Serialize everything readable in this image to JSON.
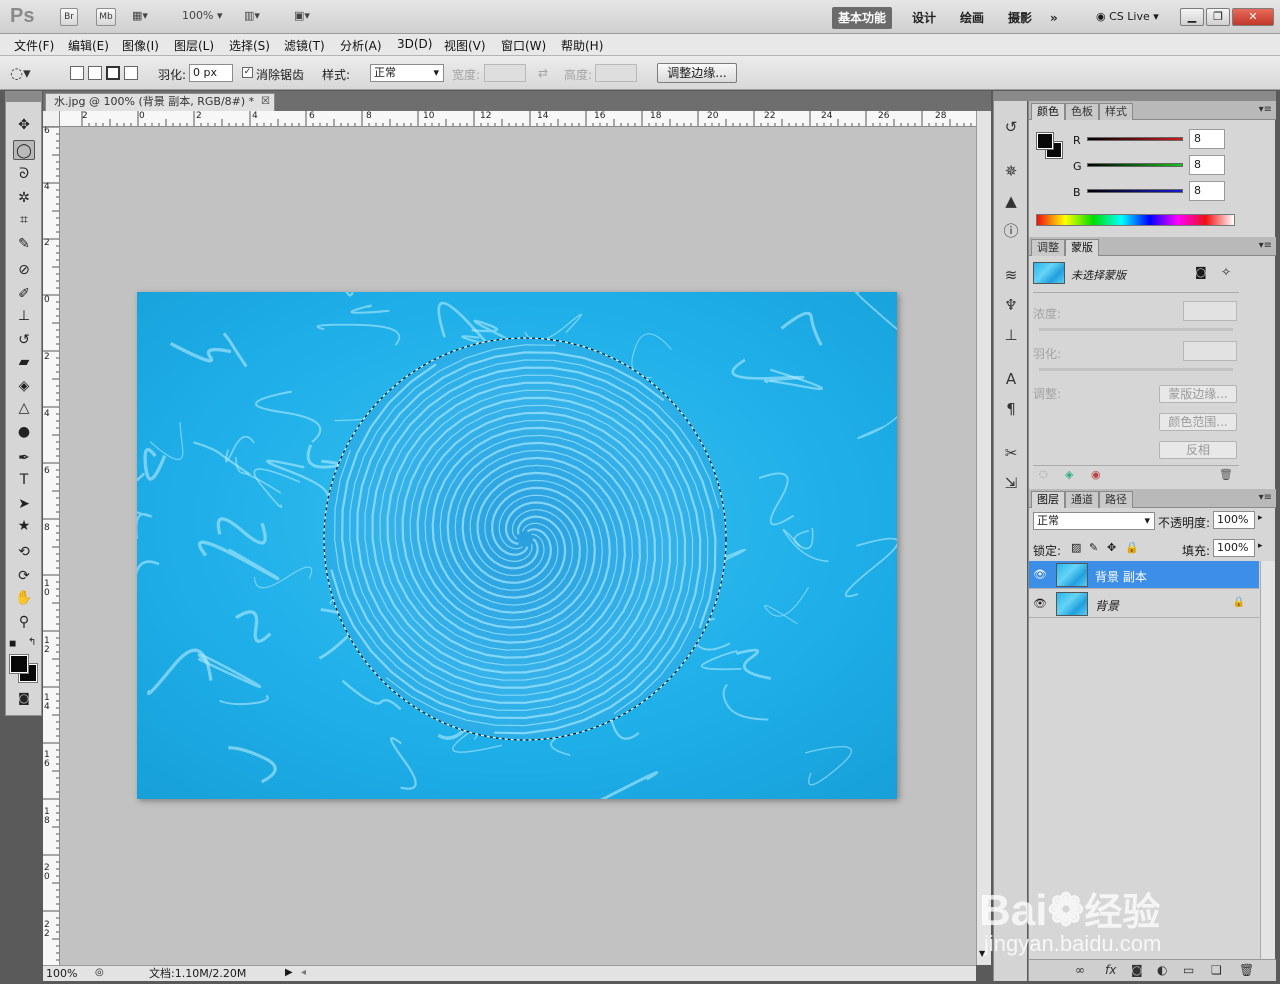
{
  "app": {
    "logo": "Ps",
    "bridge": "Br",
    "minibridge": "Mb",
    "zoom": "100%",
    "workspaces": [
      "基本功能",
      "设计",
      "绘画",
      "摄影"
    ],
    "more": "»",
    "cslive": "CS Live"
  },
  "menu": [
    "文件(F)",
    "编辑(E)",
    "图像(I)",
    "图层(L)",
    "选择(S)",
    "滤镜(T)",
    "分析(A)",
    "3D(D)",
    "视图(V)",
    "窗口(W)",
    "帮助(H)"
  ],
  "options": {
    "feather_label": "羽化:",
    "feather_value": "0 px",
    "antialias_label": "消除锯齿",
    "style_label": "样式:",
    "style_value": "正常",
    "width_label": "宽度:",
    "height_label": "高度:",
    "refine_edge": "调整边缘..."
  },
  "document": {
    "tab_title": "水.jpg @ 100% (背景 副本, RGB/8#) *",
    "ruler_top": [
      "2",
      "0",
      "2",
      "4",
      "6",
      "8",
      "10",
      "12",
      "14",
      "16",
      "18",
      "20",
      "22",
      "24",
      "26",
      "28"
    ],
    "ruler_left": [
      "6",
      "4",
      "2",
      "0",
      "2",
      "4",
      "6",
      "8",
      "10",
      "12",
      "14",
      "16",
      "18",
      "20",
      "22"
    ],
    "status_zoom": "100%",
    "status_doc": "文档:1.10M/2.20M"
  },
  "color_panel": {
    "tabs": [
      "颜色",
      "色板",
      "样式"
    ],
    "r_label": "R",
    "g_label": "G",
    "b_label": "B",
    "r": "8",
    "g": "8",
    "b": "8",
    "r_color": "#d41a1a",
    "g_color": "#19c419",
    "b_color": "#1a1ad4"
  },
  "mask_panel": {
    "tabs": [
      "调整",
      "蒙版"
    ],
    "title": "未选择蒙版",
    "density": "浓度:",
    "feather": "羽化:",
    "adjust": "调整:",
    "mask_edge": "蒙版边缘...",
    "color_range": "颜色范围...",
    "invert": "反相"
  },
  "layers_panel": {
    "tabs": [
      "图层",
      "通道",
      "路径"
    ],
    "blend_mode": "正常",
    "opacity_label": "不透明度:",
    "opacity": "100%",
    "lock_label": "锁定:",
    "fill_label": "填充:",
    "fill": "100%",
    "layers": [
      {
        "name": "背景 副本",
        "selected": true
      },
      {
        "name": "背景",
        "selected": false
      }
    ]
  },
  "watermark": {
    "brand": "Bai",
    "suffix": "经验",
    "url": "jingyan.baidu.com"
  }
}
